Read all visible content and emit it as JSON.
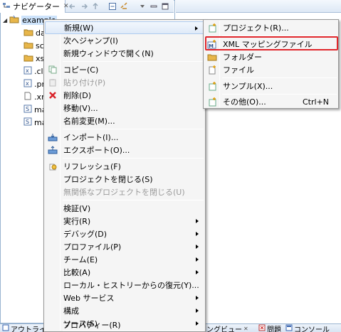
{
  "navigator": {
    "title": "ナビゲーター",
    "close_glyph": "✕",
    "tree": [
      {
        "label": "example",
        "icon": "project-icon"
      },
      {
        "label": "da",
        "icon": "folder-icon"
      },
      {
        "label": "sc",
        "icon": "folder-icon"
      },
      {
        "label": "xs",
        "icon": "folder-icon"
      },
      {
        "label": ".cl",
        "icon": "xml-file-icon"
      },
      {
        "label": ".pr",
        "icon": "xml-file-icon"
      },
      {
        "label": ".xr",
        "icon": "file-icon"
      },
      {
        "label": "ma",
        "icon": "script-file-icon"
      },
      {
        "label": "ma",
        "icon": "script-file-icon"
      }
    ]
  },
  "bottom": {
    "outline_label": "アウトライ",
    "mapping_view_label": "ングビュー",
    "problems_label": "問題",
    "console_label": "コンソール"
  },
  "context_menu": {
    "items": [
      {
        "label": "新規(W)",
        "submenu": true,
        "highlighted": true
      },
      {
        "label": "次へジャンプ(I)"
      },
      {
        "label": "新規ウィンドウで開く(N)"
      },
      {
        "label": "コピー(C)",
        "icon": "copy-icon"
      },
      {
        "label": "貼り付け(P)",
        "icon": "paste-icon",
        "disabled": true
      },
      {
        "label": "削除(D)",
        "icon": "delete-icon"
      },
      {
        "label": "移動(V)..."
      },
      {
        "label": "名前変更(M)..."
      },
      {
        "label": "インポート(I)...",
        "icon": "import-icon"
      },
      {
        "label": "エクスポート(O)...",
        "icon": "export-icon"
      },
      {
        "label": "リフレッシュ(F)",
        "icon": "refresh-icon"
      },
      {
        "label": "プロジェクトを閉じる(S)"
      },
      {
        "label": "無関係なプロジェクトを閉じる(U)",
        "disabled": true
      },
      {
        "label": "検証(V)"
      },
      {
        "label": "実行(R)",
        "submenu": true
      },
      {
        "label": "デバッグ(D)",
        "submenu": true
      },
      {
        "label": "プロファイル(P)",
        "submenu": true
      },
      {
        "label": "チーム(E)",
        "submenu": true
      },
      {
        "label": "比較(A)",
        "submenu": true
      },
      {
        "label": "ローカル・ヒストリーからの復元(Y)..."
      },
      {
        "label": "Web サービス",
        "submenu": true
      },
      {
        "label": "構成",
        "submenu": true
      },
      {
        "label": "ソース(S)",
        "submenu": true
      },
      {
        "label": "プロパティー(R)"
      }
    ]
  },
  "submenu": {
    "items": [
      {
        "label": "プロジェクト(R)...",
        "icon": "new-project-icon"
      },
      {
        "label": "XML マッピングファイル",
        "icon": "xml-mapping-icon",
        "selected": true
      },
      {
        "label": "フォルダー",
        "icon": "new-folder-icon"
      },
      {
        "label": "ファイル",
        "icon": "new-file-icon"
      },
      {
        "label": "サンプル(X)...",
        "icon": "new-sample-icon"
      },
      {
        "label": "その他(O)...",
        "icon": "new-other-icon",
        "shortcut": "Ctrl+N"
      }
    ]
  },
  "colors": {
    "selection_outline": "#e0262b",
    "delete_red": "#d9242b",
    "folder_yellow": "#e8b64a"
  }
}
